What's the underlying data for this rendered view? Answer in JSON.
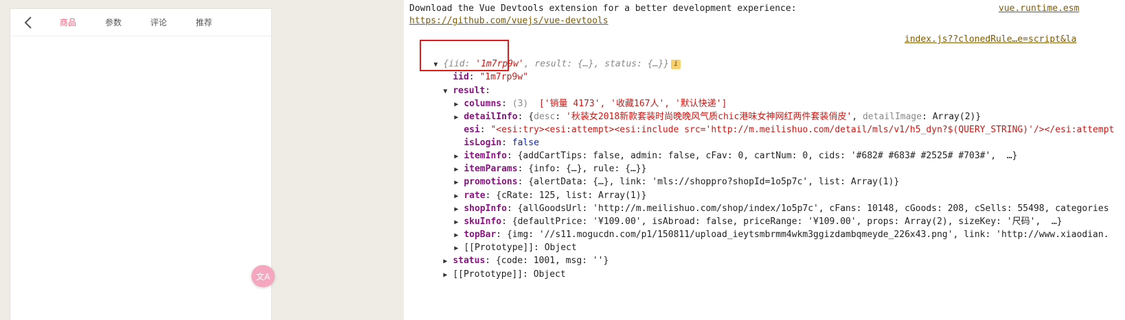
{
  "phone": {
    "tabs": [
      "商品",
      "参数",
      "评论",
      "推荐"
    ],
    "active_tab": "商品",
    "float_button_label": "文A"
  },
  "console": {
    "devtools_msg": "Download the Vue Devtools extension for a better development experience:",
    "devtools_url": "https://github.com/vuejs/vue-devtools",
    "src_top": "vue.runtime.esm",
    "src_second": "index.js??clonedRule…e=script&la",
    "summary": {
      "iid_value": "'1m7rp9w'",
      "rest": "result: {…}, status: {…}}"
    },
    "iid_line": {
      "key": "iid",
      "value": "\"1m7rp9w\""
    },
    "result_key": "result",
    "columns": {
      "key": "columns",
      "count": "(3)",
      "value": "['销量 4173', '收藏167人', '默认快递']"
    },
    "detailInfo": {
      "key": "detailInfo",
      "desc_key": "desc",
      "desc_value": "'秋装女2018新款套装时尚晚晚风气质chic港味女神网红两件套装俏皮'",
      "image_key": "detailImage",
      "image_value": "Array(2)}"
    },
    "esi": {
      "key": "esi",
      "value": "\"<esi:try><esi:attempt><esi:include src='http://m.meilishuo.com/detail/mls/v1/h5_dyn?$(QUERY_STRING)'/></esi:attempt"
    },
    "isLogin": {
      "key": "isLogin",
      "value": "false"
    },
    "itemInfo": {
      "key": "itemInfo",
      "text": "{addCartTips: false, admin: false, cFav: 0, cartNum: 0, cids: '#682# #683# #2525# #703#',  …}"
    },
    "itemParams": {
      "key": "itemParams",
      "text": "{info: {…}, rule: {…}}"
    },
    "promotions": {
      "key": "promotions",
      "text": "{alertData: {…}, link: 'mls://shoppro?shopId=1o5p7c', list: Array(1)}"
    },
    "rate": {
      "key": "rate",
      "text": "{cRate: 125, list: Array(1)}"
    },
    "shopInfo": {
      "key": "shopInfo",
      "text": "{allGoodsUrl: 'http://m.meilishuo.com/shop/index/1o5p7c', cFans: 10148, cGoods: 208, cSells: 55498, categories"
    },
    "skuInfo": {
      "key": "skuInfo",
      "text": "{defaultPrice: '¥109.00', isAbroad: false, priceRange: '¥109.00', props: Array(2), sizeKey: '尺码',  …}"
    },
    "topBar": {
      "key": "topBar",
      "text": "{img: '//s11.mogucdn.com/p1/150811/upload_ieytsmbrmm4wkm3ggizdambqmeyde_226x43.png', link: 'http://www.xiaodian."
    },
    "proto_inner": "[[Prototype]]: Object",
    "status": {
      "key": "status",
      "text": "{code: 1001, msg: ''}"
    },
    "proto_outer": "[[Prototype]]: Object",
    "prompt": "›"
  },
  "colors": {
    "accent": "#ff5777",
    "highlight_box": "#e0191b"
  }
}
